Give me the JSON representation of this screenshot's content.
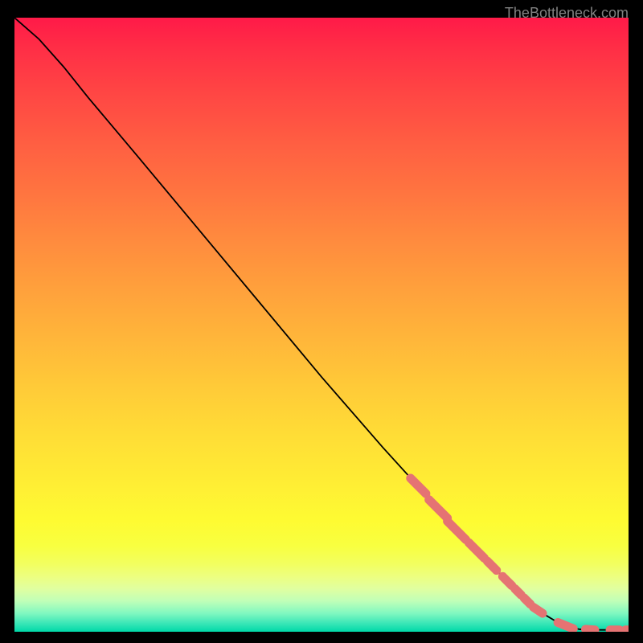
{
  "watermark": "TheBottleneck.com",
  "chart_data": {
    "type": "line",
    "title": "",
    "xlabel": "",
    "ylabel": "",
    "xlim": [
      0,
      100
    ],
    "ylim": [
      0,
      100
    ],
    "curve": [
      {
        "x": 0,
        "y": 100
      },
      {
        "x": 4,
        "y": 96.5
      },
      {
        "x": 8,
        "y": 92
      },
      {
        "x": 12,
        "y": 87
      },
      {
        "x": 20,
        "y": 77.5
      },
      {
        "x": 30,
        "y": 65.5
      },
      {
        "x": 40,
        "y": 53.5
      },
      {
        "x": 50,
        "y": 41.5
      },
      {
        "x": 60,
        "y": 30
      },
      {
        "x": 65,
        "y": 24.5
      },
      {
        "x": 70,
        "y": 19
      },
      {
        "x": 75,
        "y": 13.5
      },
      {
        "x": 80,
        "y": 8.5
      },
      {
        "x": 83,
        "y": 5.5
      },
      {
        "x": 86,
        "y": 3
      },
      {
        "x": 89,
        "y": 1.2
      },
      {
        "x": 92,
        "y": 0.4
      },
      {
        "x": 95,
        "y": 0.3
      },
      {
        "x": 98,
        "y": 0.3
      },
      {
        "x": 100,
        "y": 0.3
      }
    ],
    "marker_segments": [
      {
        "x1": 64.5,
        "y1": 25,
        "x2": 67,
        "y2": 22.5
      },
      {
        "x1": 67.5,
        "y1": 21.5,
        "x2": 70.5,
        "y2": 18.5
      },
      {
        "x1": 70.5,
        "y1": 18,
        "x2": 73.5,
        "y2": 15
      },
      {
        "x1": 74,
        "y1": 14.5,
        "x2": 76.5,
        "y2": 12
      },
      {
        "x1": 77,
        "y1": 11.5,
        "x2": 78.5,
        "y2": 10
      },
      {
        "x1": 79.5,
        "y1": 9,
        "x2": 81,
        "y2": 7.5
      },
      {
        "x1": 81.5,
        "y1": 7,
        "x2": 82.5,
        "y2": 6
      },
      {
        "x1": 83,
        "y1": 5.5,
        "x2": 84,
        "y2": 4.5
      },
      {
        "x1": 84.5,
        "y1": 4,
        "x2": 86,
        "y2": 3
      },
      {
        "x1": 88.5,
        "y1": 1.5,
        "x2": 91,
        "y2": 0.5
      },
      {
        "x1": 93,
        "y1": 0.4,
        "x2": 94.5,
        "y2": 0.3
      },
      {
        "x1": 97,
        "y1": 0.3,
        "x2": 98.5,
        "y2": 0.3
      },
      {
        "x1": 99.5,
        "y1": 0.3,
        "x2": 100,
        "y2": 0.3
      }
    ]
  }
}
